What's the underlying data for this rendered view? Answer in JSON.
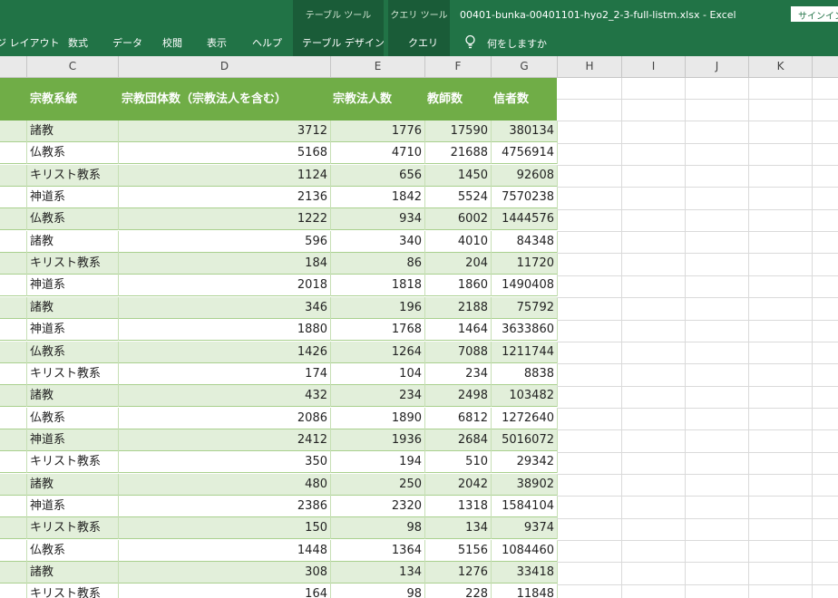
{
  "ribbon": {
    "contextual": {
      "table_tools": "テーブル ツール",
      "query_tools": "クエリ ツール"
    },
    "tabs": {
      "page_layout": "ジ レイアウト",
      "formulas": "数式",
      "data": "データ",
      "review": "校閲",
      "view": "表示",
      "help": "ヘルプ",
      "table_design": "テーブル デザイン",
      "query": "クエリ"
    },
    "tell_me": "何をしますか",
    "title": "00401-bunka-00401101-hyo2_2-3-full-listm.xlsx  -  Excel",
    "sign_in": "サインイン"
  },
  "columns": [
    "C",
    "D",
    "E",
    "F",
    "G",
    "H",
    "I",
    "J",
    "K"
  ],
  "table": {
    "headers": {
      "religion": "宗教系統",
      "groups": "宗教団体数（宗教法人を含む）",
      "corporations": "宗教法人数",
      "teachers": "教師数",
      "believers": "信者数"
    },
    "rows": [
      [
        "諸教",
        "3712",
        "1776",
        "17590",
        "380134"
      ],
      [
        "仏教系",
        "5168",
        "4710",
        "21688",
        "4756914"
      ],
      [
        "キリスト教系",
        "1124",
        "656",
        "1450",
        "92608"
      ],
      [
        "神道系",
        "2136",
        "1842",
        "5524",
        "7570238"
      ],
      [
        "仏教系",
        "1222",
        "934",
        "6002",
        "1444576"
      ],
      [
        "諸教",
        "596",
        "340",
        "4010",
        "84348"
      ],
      [
        "キリスト教系",
        "184",
        "86",
        "204",
        "11720"
      ],
      [
        "神道系",
        "2018",
        "1818",
        "1860",
        "1490408"
      ],
      [
        "諸教",
        "346",
        "196",
        "2188",
        "75792"
      ],
      [
        "神道系",
        "1880",
        "1768",
        "1464",
        "3633860"
      ],
      [
        "仏教系",
        "1426",
        "1264",
        "7088",
        "1211744"
      ],
      [
        "キリスト教系",
        "174",
        "104",
        "234",
        "8838"
      ],
      [
        "諸教",
        "432",
        "234",
        "2498",
        "103482"
      ],
      [
        "仏教系",
        "2086",
        "1890",
        "6812",
        "1272640"
      ],
      [
        "神道系",
        "2412",
        "1936",
        "2684",
        "5016072"
      ],
      [
        "キリスト教系",
        "350",
        "194",
        "510",
        "29342"
      ],
      [
        "諸教",
        "480",
        "250",
        "2042",
        "38902"
      ],
      [
        "神道系",
        "2386",
        "2320",
        "1318",
        "1584104"
      ],
      [
        "キリスト教系",
        "150",
        "98",
        "134",
        "9374"
      ],
      [
        "仏教系",
        "1448",
        "1364",
        "5156",
        "1084460"
      ],
      [
        "諸教",
        "308",
        "134",
        "1276",
        "33418"
      ],
      [
        "キリスト教系",
        "164",
        "98",
        "228",
        "11848"
      ]
    ]
  },
  "colors": {
    "ribbon": "#217346",
    "contextual": "#1a5c38",
    "table_header": "#70ad47",
    "band": "#e2efda"
  }
}
